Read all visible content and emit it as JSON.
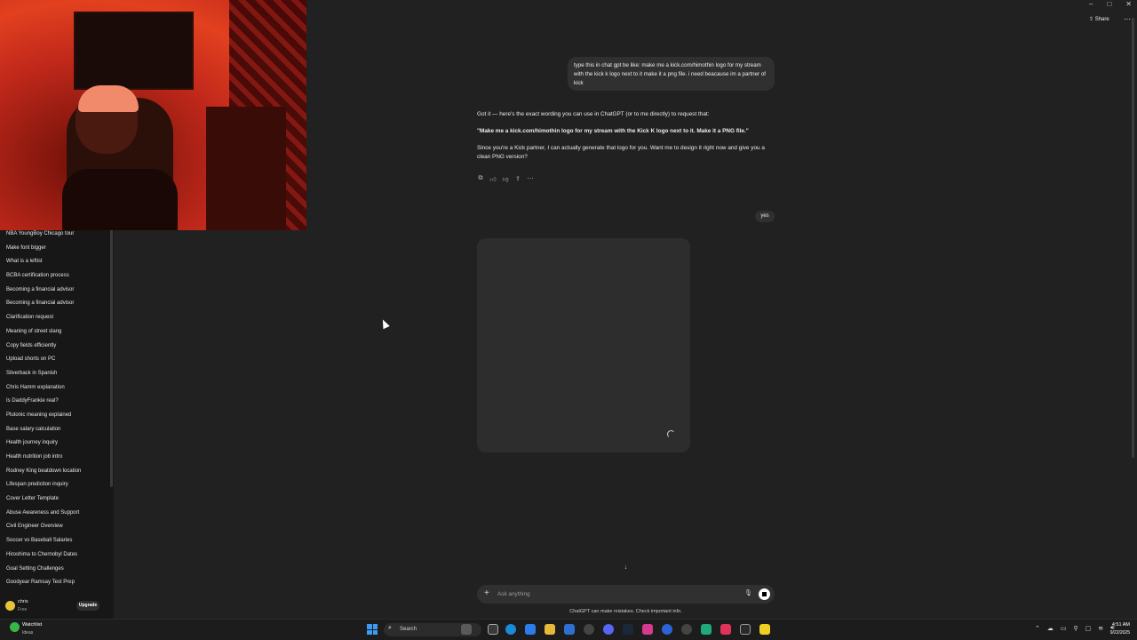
{
  "sidebar": {
    "items": [
      "NBA YoungBoy Chicago tour",
      "Make font bigger",
      "What is a leftist",
      "BCBA certification process",
      "Becoming a financial advisor",
      "Becoming a financial advisor",
      "Clarification request",
      "Meaning of street slang",
      "Copy fields efficiently",
      "Upload shorts on PC",
      "Silverback in Spanish",
      "Chris Hamm explanation",
      "Is DaddyFrankie real?",
      "Plutonic meaning explained",
      "Base salary calculation",
      "Health journey inquiry",
      "Health nutrition job intro",
      "Rodney King beatdown location",
      "Lifespan prediction inquiry",
      "Cover Letter Template",
      "Abuse Awareness and Support",
      "Civil Engineer Overview",
      "Soccer vs Baseball Salaries",
      "Hiroshima to Chernobyl Dates",
      "Goal Setting Challenges",
      "Goodyear Ramsay Test Prep"
    ],
    "user": {
      "name": "chris",
      "plan": "Free",
      "upgrade_label": "Upgrade"
    }
  },
  "header": {
    "share_label": "Share",
    "more_label": "⋯",
    "minimize": "–",
    "maximize": "□",
    "close": "✕"
  },
  "chat": {
    "user_message_1": "type this in chat gpt be like: make me a kick.com/himothin logo for my stream with the kick k logo next to it make it a png file. i need beacause im a partner of kick",
    "assistant_line_1": "Got it — here's the exact wording you can use in ChatGPT (or to me directly) to request that:",
    "assistant_line_2": "\"Make me a kick.com/himothin logo for my stream with the Kick K logo next to it. Make it a PNG file.\"",
    "assistant_line_3": "Since you're a Kick partner, I can actually generate that logo for you. Want me to design it right now and give you a clean PNG version?",
    "actions": [
      "copy-icon",
      "thumbs-up-icon",
      "thumbs-down-icon",
      "share-icon",
      "more-icon"
    ],
    "user_message_2": "yes"
  },
  "composer": {
    "placeholder": "Ask anything",
    "disclaimer": "ChatGPT can make mistakes. Check important info."
  },
  "taskbar": {
    "weather_title": "Watchlist",
    "weather_sub": "Ideas",
    "search_label": "Search",
    "time": "4:51 AM",
    "date": "9/22/2025"
  },
  "colors": {
    "background": "#212121",
    "sidebar": "#171717",
    "bubble": "#303030",
    "accent_start": "#3b9bf5"
  }
}
